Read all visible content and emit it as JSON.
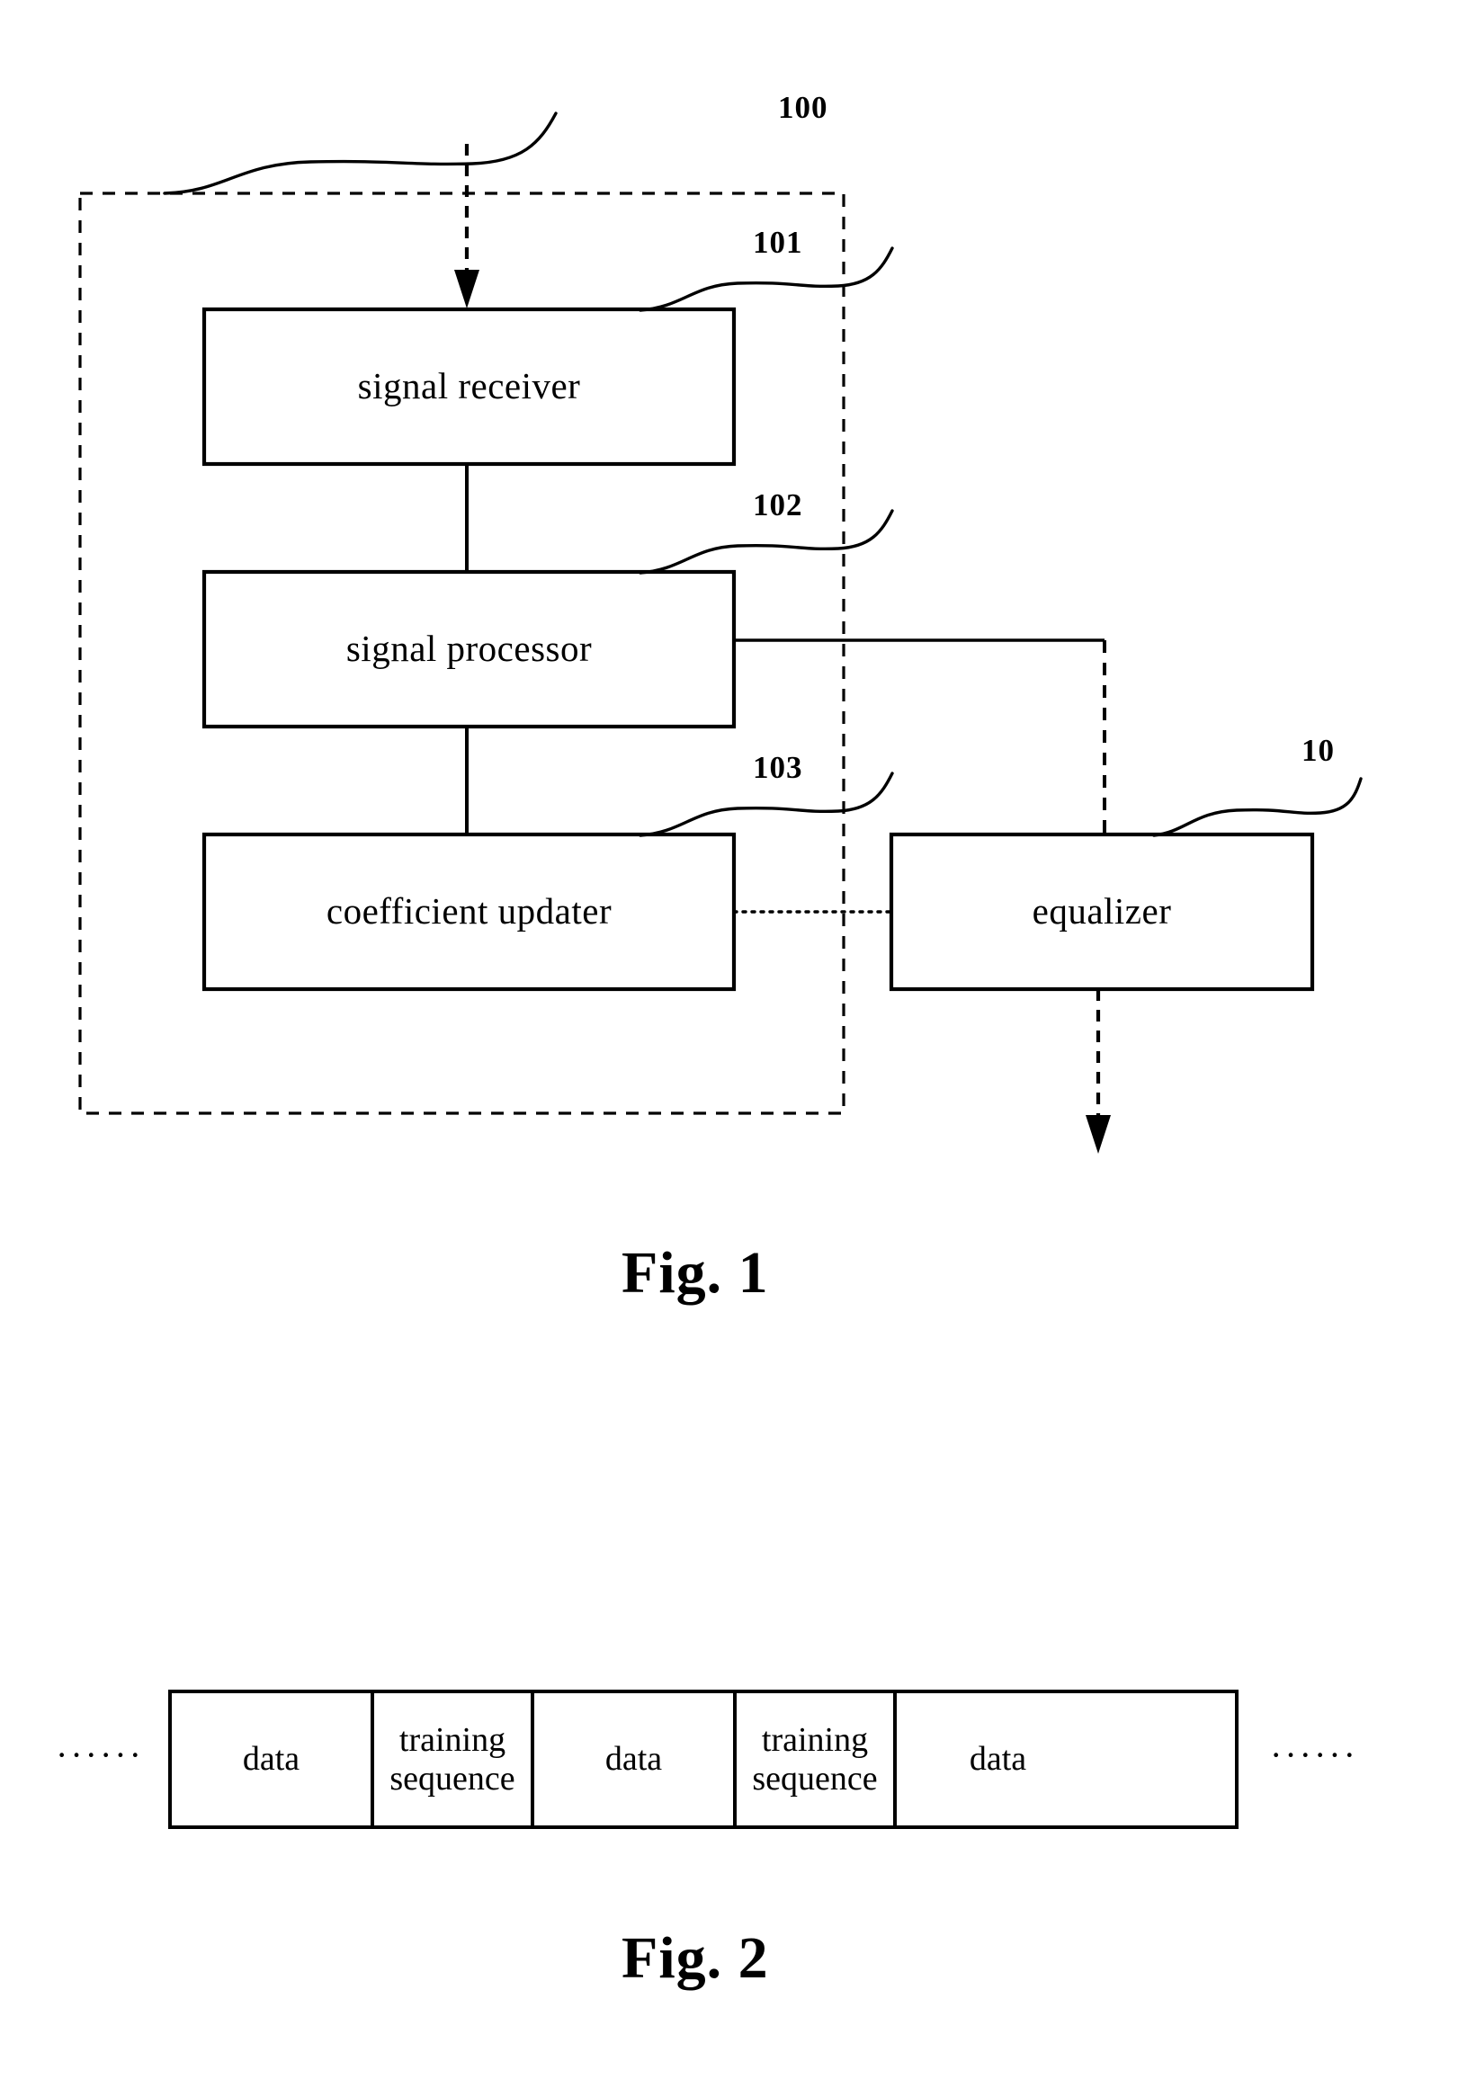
{
  "figure1": {
    "caption": "Fig. 1",
    "system_ref": "100",
    "equalizer_ref": "10",
    "blocks": [
      {
        "id": "signal-receiver",
        "label": "signal receiver",
        "ref": "101"
      },
      {
        "id": "signal-processor",
        "label": "signal processor",
        "ref": "102"
      },
      {
        "id": "coefficient-updater",
        "label": "coefficient updater",
        "ref": "103"
      },
      {
        "id": "equalizer",
        "label": "equalizer",
        "ref": "10"
      }
    ],
    "block_labels": {
      "signal_receiver": "signal receiver",
      "signal_processor": "signal processor",
      "coefficient_updater": "coefficient updater",
      "equalizer": "equalizer"
    },
    "refs": {
      "system": "100",
      "signal_receiver": "101",
      "signal_processor": "102",
      "coefficient_updater": "103",
      "equalizer": "10"
    }
  },
  "figure2": {
    "caption": "Fig. 2",
    "ellipsis_left": "······",
    "ellipsis_right": "······",
    "cells": [
      {
        "type": "data",
        "line1": "data",
        "line2": ""
      },
      {
        "type": "training",
        "line1": "training",
        "line2": "sequence"
      },
      {
        "type": "data",
        "line1": "data",
        "line2": ""
      },
      {
        "type": "training",
        "line1": "training",
        "line2": "sequence"
      },
      {
        "type": "data",
        "line1": "data",
        "line2": ""
      }
    ]
  },
  "colors": {
    "stroke": "#000000",
    "background": "#ffffff"
  }
}
